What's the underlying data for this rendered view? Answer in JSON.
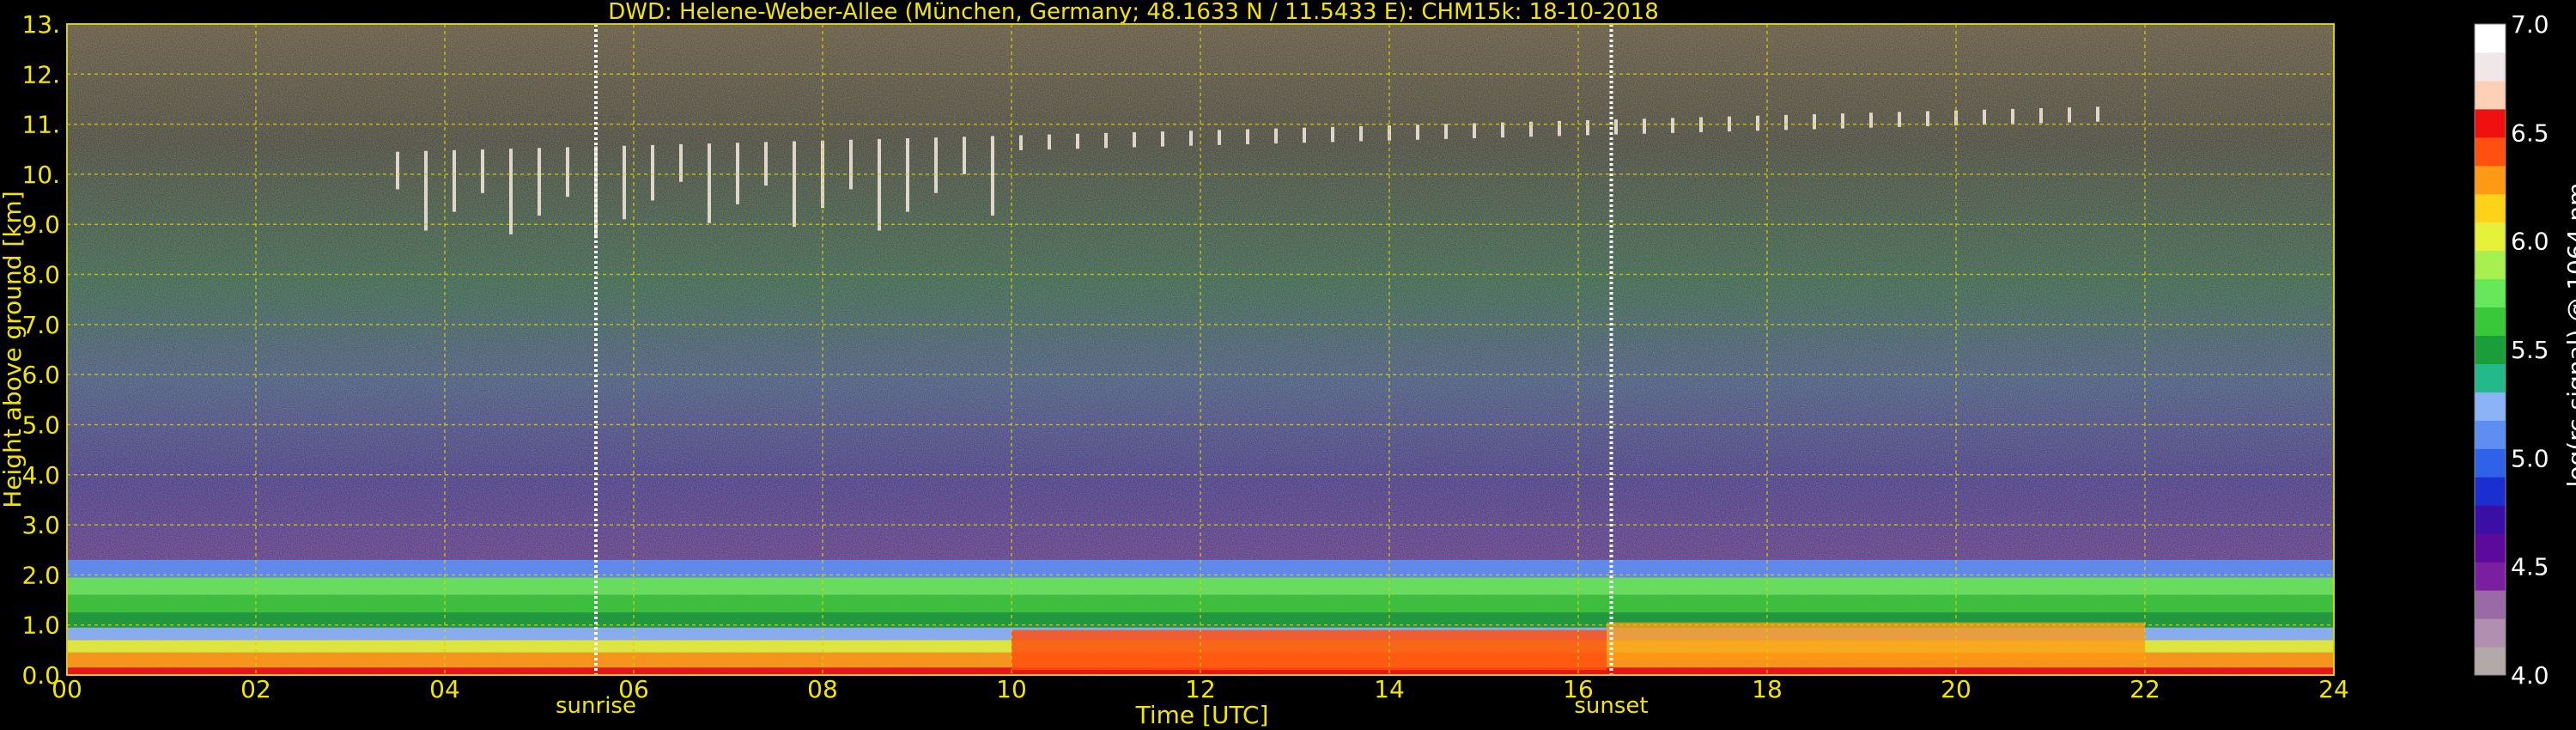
{
  "chart_data": {
    "type": "heatmap",
    "title": "DWD: Helene-Weber-Allee (München, Germany; 48.1633 N / 11.5433 E):    CHM15k: 18-10-2018",
    "xlabel": "Time [UTC]",
    "ylabel": "Height above ground [km]",
    "xlim": [
      0,
      24
    ],
    "ylim": [
      0,
      13
    ],
    "x_ticks": [
      0,
      2,
      4,
      6,
      8,
      10,
      12,
      14,
      16,
      18,
      20,
      22,
      24
    ],
    "x_tick_labels": [
      "00",
      "02",
      "04",
      "06",
      "08",
      "10",
      "12",
      "14",
      "16",
      "18",
      "20",
      "22",
      "24"
    ],
    "y_ticks": [
      0,
      1,
      2,
      3,
      4,
      5,
      6,
      7,
      8,
      9,
      10,
      11,
      12,
      13
    ],
    "y_tick_labels": [
      "0.0",
      "1.0",
      "2.0",
      "3.0",
      "4.0",
      "5.0",
      "6.0",
      "7.0",
      "8.0",
      "9.0",
      "10.",
      "11.",
      "12.",
      "13."
    ],
    "grid": true,
    "colorbar": {
      "label": "log(rc-signal) @ 1064 nm",
      "range": [
        4.0,
        7.0
      ],
      "tick_values": [
        4.0,
        4.5,
        5.0,
        5.5,
        6.0,
        6.5,
        7.0
      ],
      "tick_labels": [
        "4.0",
        "4.5",
        "5.0",
        "5.5",
        "6.0",
        "6.5",
        "7.0"
      ]
    },
    "annotations": [
      {
        "text": "sunrise",
        "x": 5.6
      },
      {
        "text": "sunset",
        "x": 16.35
      }
    ],
    "layers": [
      {
        "feature": "cirrus cloud",
        "x_start": 3.5,
        "x_end": 21.5,
        "bottom_km": 9.0,
        "top_km": 11.5
      },
      {
        "feature": "boundary layer aerosol",
        "x_start": 0,
        "x_end": 24,
        "bottom_km": 0,
        "top_km": 2.3
      }
    ]
  },
  "colors": {
    "text": "#f2e600",
    "grid": "#d8d000",
    "background": "#000000",
    "colormap": [
      "#b3a9a9",
      "#b08fb0",
      "#9a6aa6",
      "#7a1fa0",
      "#5b0a9c",
      "#3b0fa6",
      "#1b2fd0",
      "#2f62e8",
      "#5e8ef2",
      "#8ab4f6",
      "#23b98a",
      "#1a9e3a",
      "#38c838",
      "#66e85a",
      "#a8f050",
      "#e6f23a",
      "#ffd21a",
      "#ff9a14",
      "#ff5010",
      "#f01010",
      "#ffd0b8",
      "#f0e8e8",
      "#ffffff"
    ]
  }
}
